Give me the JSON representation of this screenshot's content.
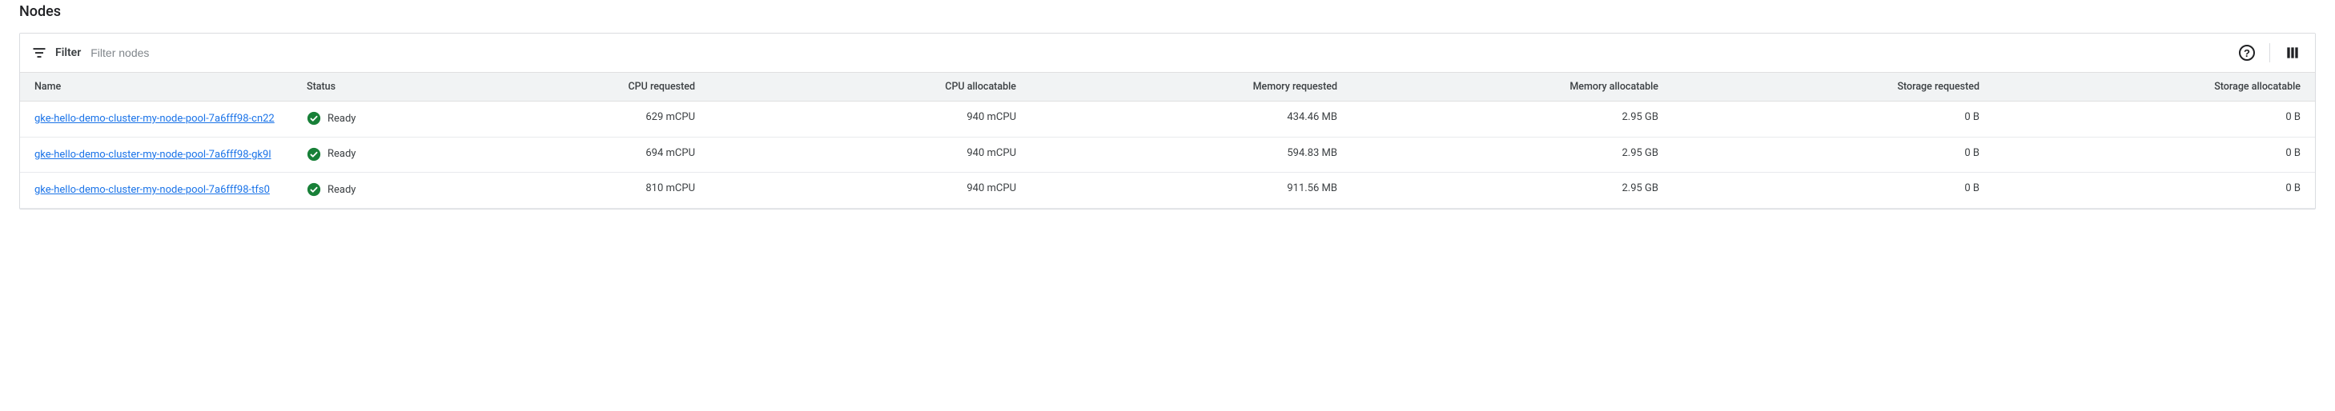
{
  "section": {
    "title": "Nodes"
  },
  "toolbar": {
    "filter_label": "Filter",
    "filter_placeholder": "Filter nodes"
  },
  "columns": {
    "name": "Name",
    "status": "Status",
    "cpu_requested": "CPU requested",
    "cpu_allocatable": "CPU allocatable",
    "memory_requested": "Memory requested",
    "memory_allocatable": "Memory allocatable",
    "storage_requested": "Storage requested",
    "storage_allocatable": "Storage allocatable"
  },
  "rows": [
    {
      "name": "gke-hello-demo-cluster-my-node-pool-7a6fff98-cn22",
      "status": "Ready",
      "cpu_requested": "629 mCPU",
      "cpu_allocatable": "940 mCPU",
      "memory_requested": "434.46 MB",
      "memory_allocatable": "2.95 GB",
      "storage_requested": "0 B",
      "storage_allocatable": "0 B"
    },
    {
      "name": "gke-hello-demo-cluster-my-node-pool-7a6fff98-gk9l",
      "status": "Ready",
      "cpu_requested": "694 mCPU",
      "cpu_allocatable": "940 mCPU",
      "memory_requested": "594.83 MB",
      "memory_allocatable": "2.95 GB",
      "storage_requested": "0 B",
      "storage_allocatable": "0 B"
    },
    {
      "name": "gke-hello-demo-cluster-my-node-pool-7a6fff98-tfs0",
      "status": "Ready",
      "cpu_requested": "810 mCPU",
      "cpu_allocatable": "940 mCPU",
      "memory_requested": "911.56 MB",
      "memory_allocatable": "2.95 GB",
      "storage_requested": "0 B",
      "storage_allocatable": "0 B"
    }
  ]
}
